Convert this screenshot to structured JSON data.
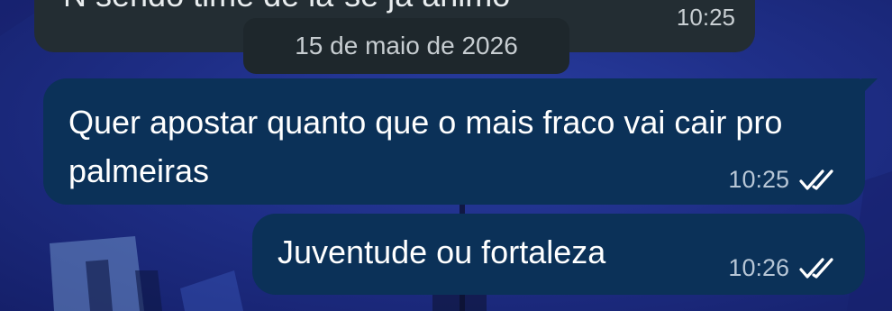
{
  "previous_message": {
    "partial_text": "N sendo time de lá-se já ânimo",
    "time": "10:25"
  },
  "date_divider": "15 de maio de 2026",
  "messages": [
    {
      "text": "Quer apostar quanto que o mais fraco vai cair pro palmeiras",
      "time": "10:25",
      "status_icon": "double-check-icon"
    },
    {
      "text": "Juventude ou fortaleza",
      "time": "10:26",
      "status_icon": "double-check-icon"
    }
  ],
  "colors": {
    "wallpaper": "#1f2f88",
    "incoming_bubble": "#232d33",
    "outgoing_bubble": "#0b3158",
    "date_chip": "#1e272c",
    "meta_text": "#b7c6d6"
  }
}
